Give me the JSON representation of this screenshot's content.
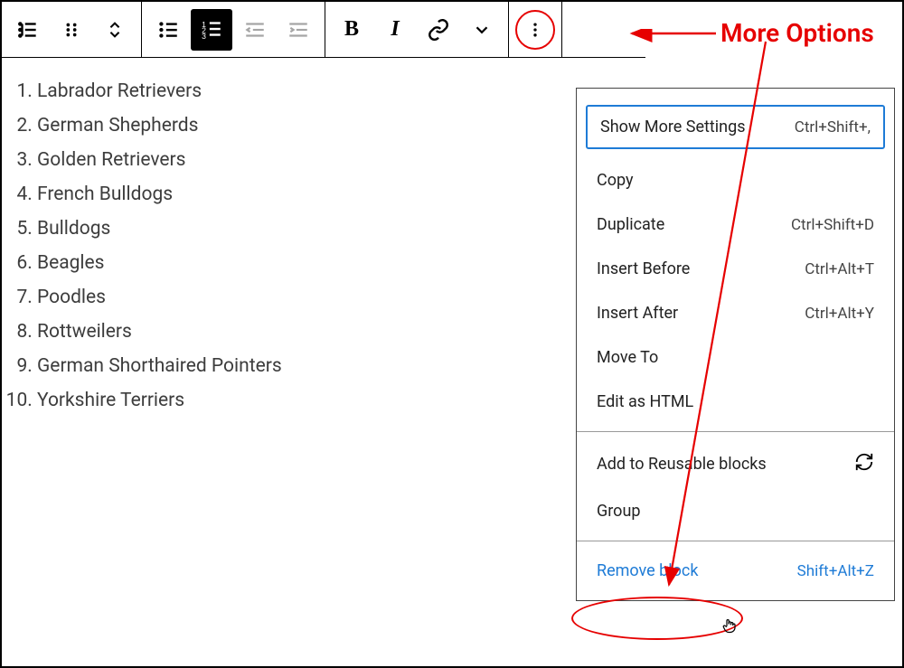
{
  "annotation": {
    "label": "More Options"
  },
  "list_items": [
    "Labrador Retrievers",
    "German Shepherds",
    "Golden Retrievers",
    "French Bulldogs",
    "Bulldogs",
    "Beagles",
    "Poodles",
    "Rottweilers",
    "German Shorthaired Pointers",
    "Yorkshire Terriers"
  ],
  "menu": {
    "section1": [
      {
        "label": "Show More Settings",
        "shortcut": "Ctrl+Shift+,",
        "highlighted": true
      },
      {
        "label": "Copy",
        "shortcut": ""
      },
      {
        "label": "Duplicate",
        "shortcut": "Ctrl+Shift+D"
      },
      {
        "label": "Insert Before",
        "shortcut": "Ctrl+Alt+T"
      },
      {
        "label": "Insert After",
        "shortcut": "Ctrl+Alt+Y"
      },
      {
        "label": "Move To",
        "shortcut": ""
      },
      {
        "label": "Edit as HTML",
        "shortcut": ""
      }
    ],
    "section2": [
      {
        "label": "Add to Reusable blocks",
        "icon": "refresh"
      },
      {
        "label": "Group"
      }
    ],
    "section3": [
      {
        "label": "Remove block",
        "shortcut": "Shift+Alt+Z",
        "link": true
      }
    ]
  }
}
